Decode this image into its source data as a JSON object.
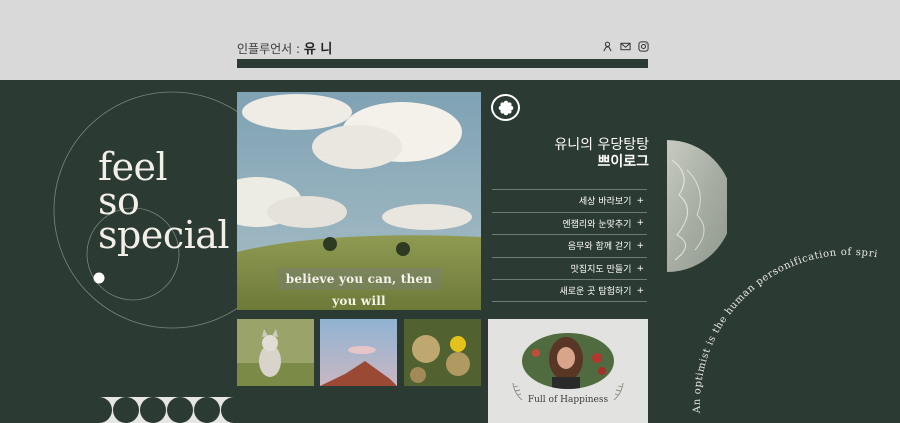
{
  "header": {
    "title_prefix": "인플루언서 : ",
    "title_name": "유 니",
    "icons": [
      "user-icon",
      "mail-icon",
      "instagram-icon"
    ]
  },
  "hero": {
    "line1": "feel",
    "line2": "so",
    "line3": "special"
  },
  "photo": {
    "quote": "believe you can, then you will"
  },
  "blog": {
    "title_line1": "유니의 우당탕탕",
    "title_line2": "쁘이로그",
    "menu": [
      {
        "label": "세상 바라보기",
        "plus": "+"
      },
      {
        "label": "엔잽리와 눈맞추기",
        "plus": "+"
      },
      {
        "label": "음무와 함께 걷기",
        "plus": "+"
      },
      {
        "label": "맛집지도 만들기",
        "plus": "+"
      },
      {
        "label": "새로운 곳 탐험하기",
        "plus": "+"
      }
    ]
  },
  "profile_card": {
    "caption": "Full of Happiness"
  },
  "arc_text": "An optimist is the human personification of spring",
  "colors": {
    "top_bg": "#d9d9d9",
    "main_bg": "#2b3a32",
    "text_light": "#ffffff"
  }
}
